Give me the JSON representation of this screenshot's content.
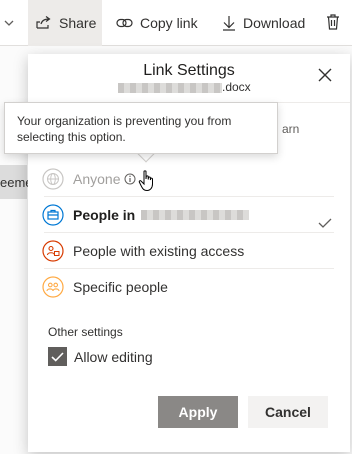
{
  "toolbar": {
    "share_label": "Share",
    "copy_link_label": "Copy link",
    "download_label": "Download",
    "icons": [
      "chevron-down-icon",
      "share-icon",
      "link-icon",
      "download-icon",
      "trash-icon"
    ]
  },
  "background": {
    "row_fragment": "eeme"
  },
  "dialog": {
    "title": "Link Settings",
    "file_suffix": ".docx",
    "learn_fragment": "arn",
    "options": [
      {
        "label": "Anyone",
        "state": "disabled",
        "icon": "globe-icon"
      },
      {
        "label": "People in",
        "state": "selected",
        "icon": "organization-icon"
      },
      {
        "label": "People with existing access",
        "state": "normal",
        "icon": "people-existing-icon"
      },
      {
        "label": "Specific people",
        "state": "normal",
        "icon": "specific-people-icon"
      }
    ],
    "other_settings_label": "Other settings",
    "allow_editing_label": "Allow editing",
    "allow_editing_checked": true,
    "apply_label": "Apply",
    "cancel_label": "Cancel"
  },
  "tooltip": {
    "text": "Your organization is preventing you from selecting this option."
  },
  "colors": {
    "org_blue": "#0078d4",
    "existing_red": "#d83b01",
    "specific_orange": "#ffaa44",
    "apply_disabled": "#8a8886"
  }
}
